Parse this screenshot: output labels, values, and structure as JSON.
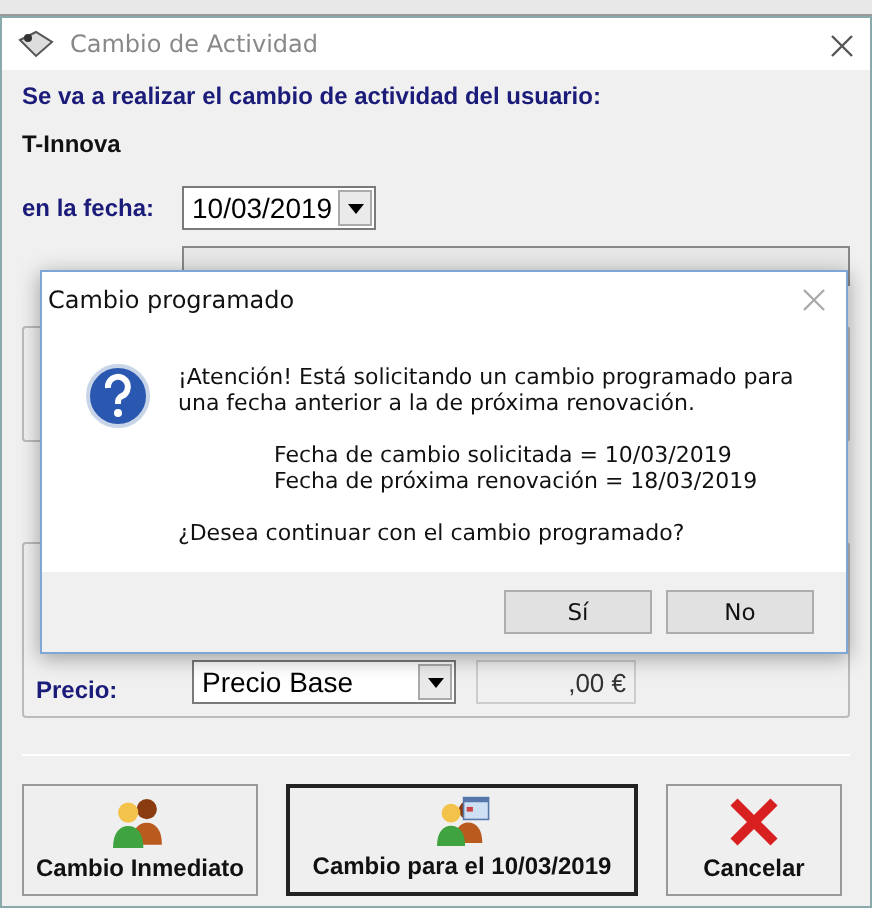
{
  "window": {
    "title": "Cambio de Actividad"
  },
  "heading": "Se va a realizar el cambio de actividad del usuario:",
  "user": "T-Innova",
  "date_field": {
    "label": "en la fecha:",
    "value": "10/03/2019"
  },
  "price": {
    "label": "Precio:",
    "option": "Precio Base",
    "amount": ",00 €"
  },
  "buttons": [
    {
      "label": "Cambio Inmediato",
      "kind": "people",
      "default": false
    },
    {
      "label": "Cambio para el 10/03/2019",
      "kind": "calendar",
      "default": true
    },
    {
      "label": "Cancelar",
      "kind": "cancel",
      "default": false
    }
  ],
  "dialog": {
    "title": "Cambio programado",
    "message": "¡Atención! Está solicitando un cambio programado para una fecha anterior a la de próxima renovación.",
    "details": [
      "Fecha de cambio solicitada = 10/03/2019",
      "Fecha de próxima renovación = 18/03/2019"
    ],
    "question": "¿Desea continuar con el cambio programado?",
    "buttons": [
      {
        "label": "Sí"
      },
      {
        "label": "No"
      }
    ]
  }
}
